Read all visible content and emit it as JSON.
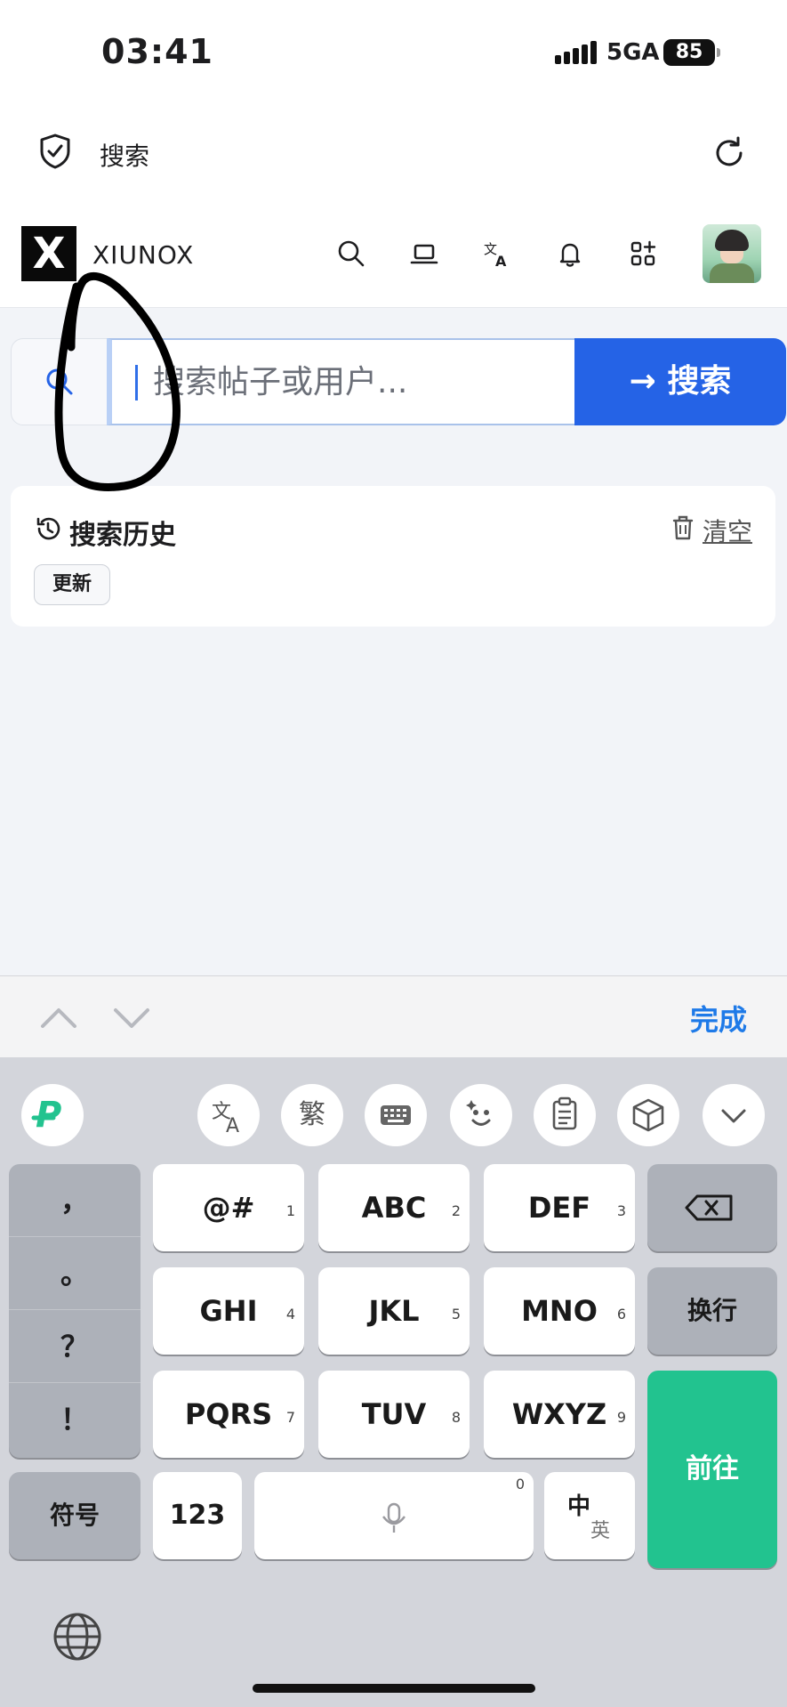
{
  "status": {
    "time": "03:41",
    "network": "5GA",
    "battery": "85"
  },
  "browser": {
    "title": "搜索"
  },
  "site": {
    "logo_letter": "X",
    "brand": "XIUNOX"
  },
  "search": {
    "placeholder": "搜索帖子或用户...",
    "button": "→ 搜索"
  },
  "history": {
    "title": "搜索历史",
    "clear": "清空",
    "tags": [
      "更新"
    ]
  },
  "kb_toolbar": {
    "done": "完成"
  },
  "keyboard": {
    "candidates": [
      "繁"
    ],
    "punct": [
      "，",
      "。",
      "？",
      "！"
    ],
    "rows": [
      [
        {
          "label": "@#",
          "num": "1"
        },
        {
          "label": "ABC",
          "num": "2"
        },
        {
          "label": "DEF",
          "num": "3"
        }
      ],
      [
        {
          "label": "GHI",
          "num": "4"
        },
        {
          "label": "JKL",
          "num": "5"
        },
        {
          "label": "MNO",
          "num": "6"
        }
      ],
      [
        {
          "label": "PQRS",
          "num": "7"
        },
        {
          "label": "TUV",
          "num": "8"
        },
        {
          "label": "WXYZ",
          "num": "9"
        }
      ]
    ],
    "newline": "换行",
    "symbols": "符号",
    "numbers": "123",
    "space_num": "0",
    "lang_top": "中",
    "lang_bottom": "英",
    "go": "前往"
  }
}
